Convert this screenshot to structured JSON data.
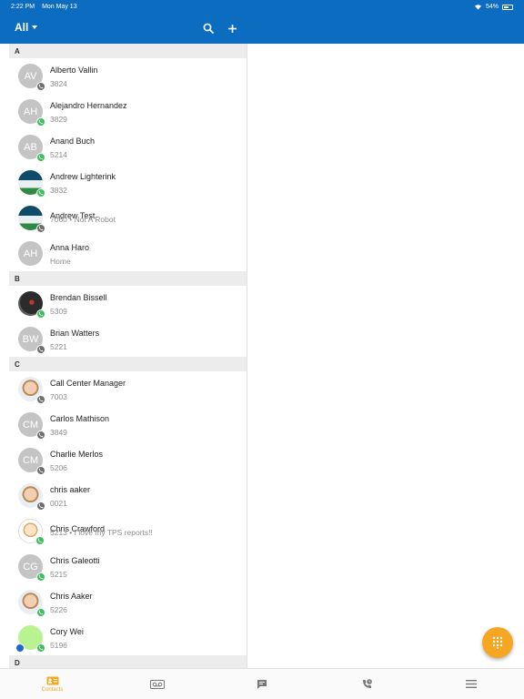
{
  "status_bar": {
    "time": "2:22 PM",
    "date": "Mon May 13",
    "battery": "54%"
  },
  "app_bar": {
    "filter_label": "All",
    "bar_color": "#0b6cc0"
  },
  "sections": [
    {
      "letter": "A",
      "contacts": [
        {
          "name": "Alberto Vallin",
          "detail": "3824",
          "initials": "AV",
          "avatar": "initials",
          "status": "gray"
        },
        {
          "name": "Alejandro Hernandez",
          "detail": "3829",
          "initials": "AH",
          "avatar": "initials",
          "status": "green"
        },
        {
          "name": "Anand Buch",
          "detail": "5214",
          "initials": "AB",
          "avatar": "initials",
          "status": "green"
        },
        {
          "name": "Andrew Lighterink",
          "detail": "3832",
          "initials": "",
          "avatar": "bear-flag-photo",
          "status": "green"
        },
        {
          "name": "Andrew Test",
          "detail": "7060 • Not A Robot",
          "initials": "",
          "avatar": "bear-flag-photo",
          "status": "gray"
        },
        {
          "name": "Anna Haro",
          "detail": "Home",
          "initials": "AH",
          "avatar": "initials",
          "status": "none"
        }
      ]
    },
    {
      "letter": "B",
      "contacts": [
        {
          "name": "Brendan Bissell",
          "detail": "5309",
          "initials": "",
          "avatar": "dark-photo",
          "status": "green"
        },
        {
          "name": "Brian Watters",
          "detail": "5221",
          "initials": "BW",
          "avatar": "initials",
          "status": "gray"
        }
      ]
    },
    {
      "letter": "C",
      "contacts": [
        {
          "name": "Call Center Manager",
          "detail": "7003",
          "initials": "",
          "avatar": "face-photo",
          "status": "gray"
        },
        {
          "name": "Carlos Mathison",
          "detail": "3849",
          "initials": "CM",
          "avatar": "initials",
          "status": "gray"
        },
        {
          "name": "Charlie Merlos",
          "detail": "5206",
          "initials": "CM",
          "avatar": "initials",
          "status": "gray"
        },
        {
          "name": "chris aaker",
          "detail": "0021",
          "initials": "",
          "avatar": "face-photo",
          "status": "gray"
        },
        {
          "name": "Chris Crawford",
          "detail": "5213 • I love my TPS reports!!",
          "initials": "",
          "avatar": "cartoon-photo",
          "status": "green"
        },
        {
          "name": "Chris Galeotti",
          "detail": "5215",
          "initials": "CG",
          "avatar": "initials",
          "status": "green"
        },
        {
          "name": "Chris Aaker",
          "detail": "5226",
          "initials": "",
          "avatar": "face-photo",
          "status": "green"
        },
        {
          "name": "Cory Wei",
          "detail": "5196",
          "initials": "",
          "avatar": "parrot-photo",
          "status": "green",
          "chat_badge": true
        }
      ]
    },
    {
      "letter": "D",
      "contacts": []
    }
  ],
  "fab": {
    "icon": "dialpad-icon",
    "color": "#f5a623"
  },
  "tabs": [
    {
      "id": "contacts",
      "label": "Contacts",
      "icon": "contacts-icon",
      "active": true
    },
    {
      "id": "voicemail",
      "label": "",
      "icon": "voicemail-icon",
      "active": false
    },
    {
      "id": "chat",
      "label": "",
      "icon": "chat-icon",
      "active": false
    },
    {
      "id": "recents",
      "label": "",
      "icon": "recent-calls-icon",
      "active": false
    },
    {
      "id": "menu",
      "label": "",
      "icon": "menu-icon",
      "active": false
    }
  ]
}
